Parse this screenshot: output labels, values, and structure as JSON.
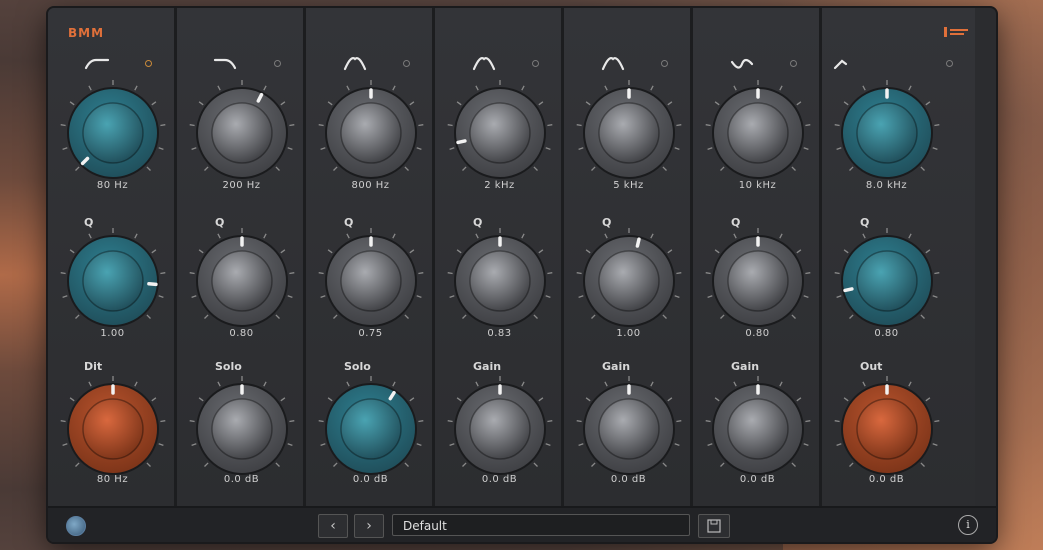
{
  "brand": {
    "left": "BMM",
    "right": ""
  },
  "columns": [
    {
      "filter_icon": "low-shelf-icon",
      "dot_color": "amber",
      "rows": [
        {
          "label": "",
          "value": "80 Hz",
          "color": "teal",
          "level": 0.0
        },
        {
          "label": "Q",
          "value": "1.00",
          "color": "teal",
          "level": 0.85
        },
        {
          "label": "Dit",
          "value": "80 Hz",
          "color": "orange",
          "level": 0.5
        }
      ]
    },
    {
      "filter_icon": "high-shelf-icon",
      "dot_color": "grey",
      "rows": [
        {
          "label": "",
          "value": "200 Hz",
          "color": "grey",
          "level": 0.6
        },
        {
          "label": "Q",
          "value": "0.80",
          "color": "grey",
          "level": 0.5
        },
        {
          "label": "Solo",
          "value": "0.0 dB",
          "color": "grey",
          "level": 0.5
        }
      ]
    },
    {
      "filter_icon": "bell-icon",
      "dot_color": "grey",
      "rows": [
        {
          "label": "",
          "value": "800 Hz",
          "color": "grey",
          "level": 0.5
        },
        {
          "label": "Q",
          "value": "0.75",
          "color": "grey",
          "level": 0.5
        },
        {
          "label": "Solo",
          "value": "0.0 dB",
          "color": "teal",
          "level": 0.62
        }
      ]
    },
    {
      "filter_icon": "bell-icon",
      "dot_color": "grey",
      "rows": [
        {
          "label": "",
          "value": "2 kHz",
          "color": "grey",
          "level": 0.12
        },
        {
          "label": "Q",
          "value": "0.83",
          "color": "grey",
          "level": 0.5
        },
        {
          "label": "Gain",
          "value": "0.0 dB",
          "color": "grey",
          "level": 0.5
        }
      ]
    },
    {
      "filter_icon": "bell-icon",
      "dot_color": "grey",
      "rows": [
        {
          "label": "",
          "value": "5 kHz",
          "color": "grey",
          "level": 0.5
        },
        {
          "label": "Q",
          "value": "1.00",
          "color": "grey",
          "level": 0.55
        },
        {
          "label": "Gain",
          "value": "0.0 dB",
          "color": "grey",
          "level": 0.5
        }
      ]
    },
    {
      "filter_icon": "notch-icon",
      "dot_color": "grey",
      "rows": [
        {
          "label": "",
          "value": "10 kHz",
          "color": "grey",
          "level": 0.5
        },
        {
          "label": "Q",
          "value": "0.80",
          "color": "grey",
          "level": 0.5
        },
        {
          "label": "Gain",
          "value": "0.0 dB",
          "color": "grey",
          "level": 0.5
        }
      ]
    },
    {
      "filter_icon": "high-cut-icon",
      "dot_color": "grey",
      "rows": [
        {
          "label": "",
          "value": "8.0 kHz",
          "color": "teal",
          "level": 0.5
        },
        {
          "label": "Q",
          "value": "0.80",
          "color": "teal",
          "level": 0.12
        },
        {
          "label": "Out",
          "value": "0.0 dB",
          "color": "orange",
          "level": 0.5
        }
      ]
    }
  ],
  "bottombar": {
    "prev_label": "‹",
    "next_label": "›",
    "preset_name": "Default",
    "info_label": "i"
  },
  "colors": {
    "teal": "#4aa3b2",
    "orange": "#d9683e",
    "grey": "#a9abb0"
  }
}
